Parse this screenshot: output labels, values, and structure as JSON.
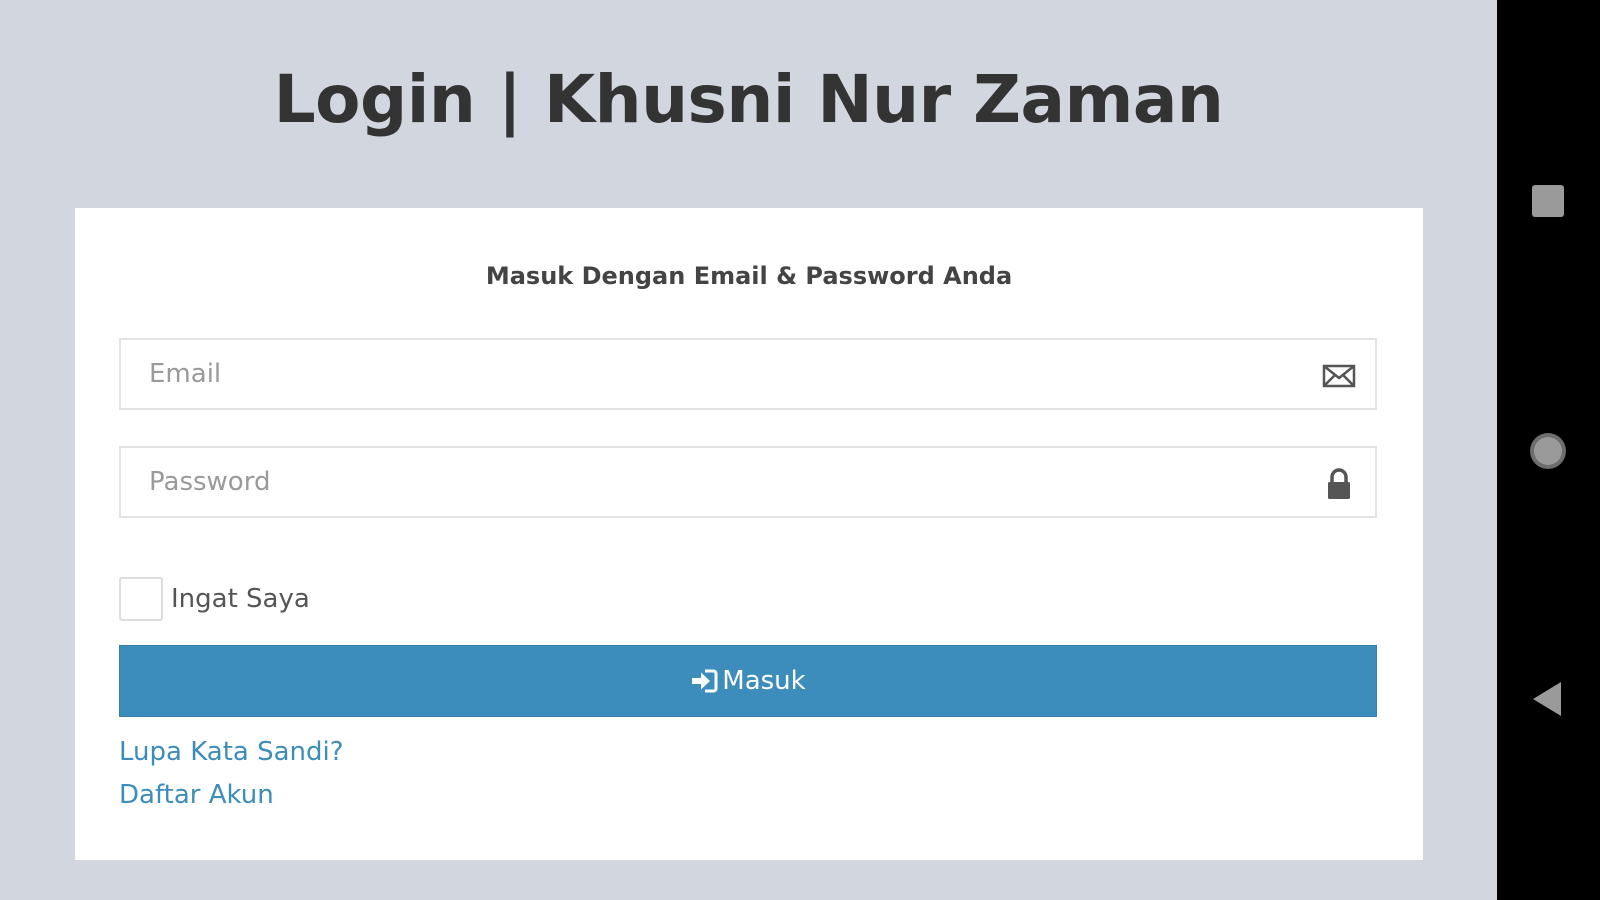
{
  "header": {
    "title": "Login | Khusni Nur Zaman"
  },
  "login_box": {
    "message": "Masuk Dengan Email & Password Anda",
    "email": {
      "placeholder": "Email",
      "value": "",
      "icon": "envelope-icon"
    },
    "password": {
      "placeholder": "Password",
      "value": "",
      "icon": "lock-icon"
    },
    "remember_me": {
      "label": "Ingat Saya",
      "checked": false
    },
    "submit": {
      "label": "Masuk",
      "icon": "sign-in-icon"
    },
    "links": {
      "forgot_password": "Lupa Kata Sandi?",
      "register": "Daftar Akun"
    }
  },
  "navigation_bar": {
    "buttons": [
      "recents-icon",
      "home-icon",
      "back-icon"
    ]
  },
  "colors": {
    "background": "#d2d6de",
    "card": "#ffffff",
    "primary": "#3c8dbc",
    "title_text": "#333333",
    "nav_bar": "#000000"
  }
}
